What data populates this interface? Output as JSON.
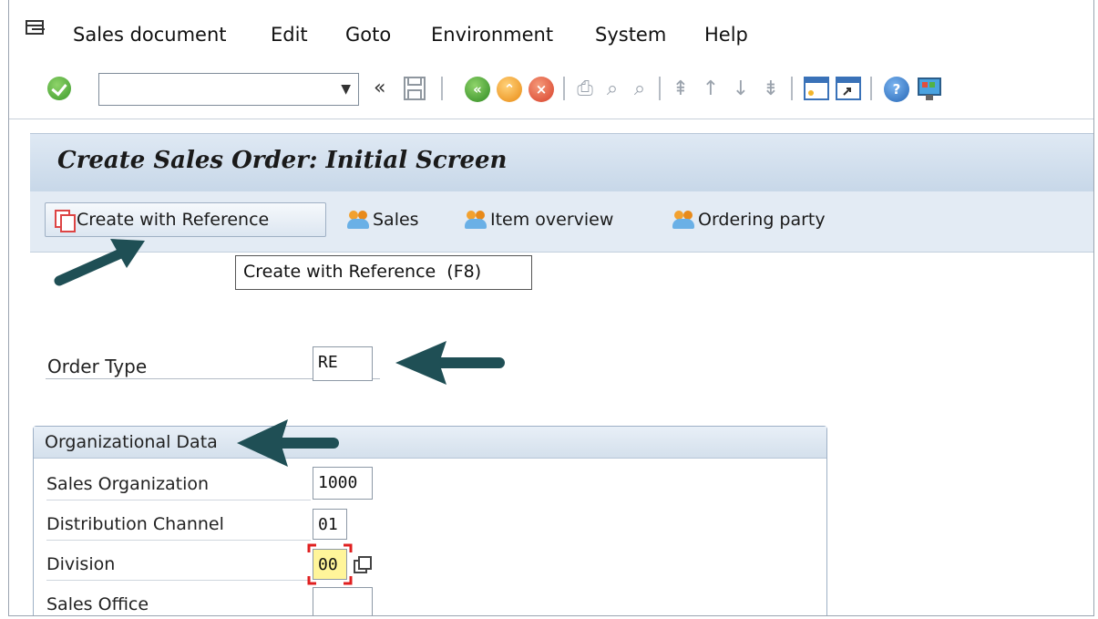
{
  "menu": {
    "items": [
      {
        "label": "Sales document"
      },
      {
        "label": "Edit"
      },
      {
        "label": "Goto"
      },
      {
        "label": "Environment"
      },
      {
        "label": "System"
      },
      {
        "label": "Help"
      }
    ]
  },
  "toolbar": {
    "command_field_value": "",
    "icons": [
      "enter-icon",
      "command-dropdown-icon",
      "collapse-icon",
      "save-icon",
      "back-icon",
      "exit-icon",
      "cancel-icon",
      "print-icon",
      "find-icon",
      "find-next-icon",
      "first-page-icon",
      "previous-page-icon",
      "next-page-icon",
      "last-page-icon",
      "new-session-icon",
      "shortcut-icon",
      "help-icon",
      "layout-icon"
    ]
  },
  "title": "Create Sales Order: Initial Screen",
  "app_toolbar": {
    "create_with_reference": "Create with Reference",
    "sales": "Sales",
    "item_overview": "Item overview",
    "ordering_party": "Ordering party"
  },
  "tooltip": "Create with Reference  (F8)",
  "order_type": {
    "label": "Order Type",
    "value": "RE"
  },
  "org_data": {
    "title": "Organizational Data",
    "fields": [
      {
        "label": "Sales Organization",
        "value": "1000"
      },
      {
        "label": "Distribution Channel",
        "value": "01"
      },
      {
        "label": "Division",
        "value": "00"
      },
      {
        "label": "Sales Office",
        "value": ""
      }
    ]
  },
  "colors": {
    "title_bg": "#c7d7e8",
    "arrow": "#1f4f55",
    "field_highlight": "#fff59a",
    "focus_marker": "#e02020"
  }
}
